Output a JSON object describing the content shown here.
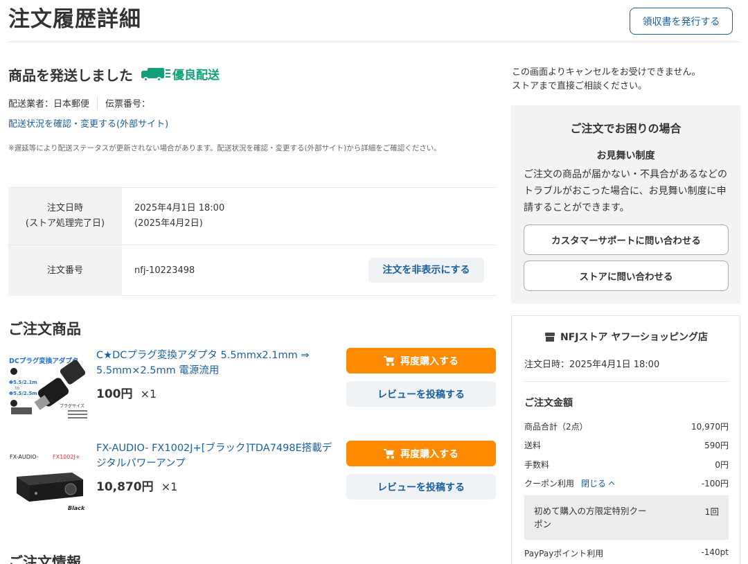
{
  "page": {
    "title": "注文履歴詳細",
    "receipt_button": "領収書を発行する"
  },
  "shipping": {
    "status": "商品を発送しました",
    "badge": "優良配送",
    "carrier_label": "配送業者：日本郵便",
    "tracking_label": "伝票番号：",
    "track_link": "配送状況を確認・変更する(外部サイト)",
    "note": "※遅延等により配送ステータスが更新されない場合があります。配送状況を確認・変更する(外部サイト)から詳細をご確認ください。"
  },
  "order_info": {
    "date_header_line1": "注文日時",
    "date_header_line2": "(ストア処理完了日)",
    "date_value": "2025年4月1日 18:00",
    "date_processed": "(2025年4月2日)",
    "number_header": "注文番号",
    "number_value": "nfj-10223498",
    "hide_button": "注文を非表示にする"
  },
  "items_section": {
    "title": "ご注文商品",
    "next_section_title": "ご注文情報",
    "items": [
      {
        "name": "C★DCプラグ変換アダプタ 5.5mmx2.1mm ⇒ 5.5mm×2.5mm 電源流用",
        "price": "100円",
        "qty": "×1",
        "rebuy_label": "再度購入する",
        "review_label": "レビューを投稿する",
        "thumb": {
          "title": "DCプラグ変換アダプタ",
          "spec1": "Φ5.5/2.1m",
          "spec_to": "to",
          "spec2": "Φ5.5/2.5m",
          "caption": "プラグサイズ"
        }
      },
      {
        "name": "FX-AUDIO- FX1002J+[ブラック]TDA7498E搭載デジタルパワーアンプ",
        "price": "10,870円",
        "qty": "×1",
        "rebuy_label": "再度購入する",
        "review_label": "レビューを投稿する",
        "thumb": {
          "brand": "FX-AUDIO-",
          "model": "FX1002J+",
          "color": "Black"
        }
      }
    ]
  },
  "sidebar": {
    "cancel_note_line1": "この画面よりキャンセルをお受けできません。",
    "cancel_note_line2": "ストアまで直接ご相談ください。",
    "help": {
      "title": "ご注文でお困りの場合",
      "subtitle": "お見舞い制度",
      "text": "ご注文の商品が届かない・不具合があるなどのトラブルがおこった場合に、お見舞い制度に申請することができます。",
      "support_button": "カスタマーサポートに問い合わせる",
      "store_button": "ストアに問い合わせる"
    },
    "store": {
      "name": "NFJストア ヤフーショッピング店",
      "order_date": "注文日時：2025年4月1日 18:00",
      "amount_title": "ご注文金額",
      "rows": [
        {
          "label": "商品合計（2点）",
          "value": "10,970円"
        },
        {
          "label": "送料",
          "value": "590円"
        },
        {
          "label": "手数料",
          "value": "0円"
        },
        {
          "label": "クーポン利用",
          "value": "-100円",
          "toggle": "閉じる"
        },
        {
          "label": "PayPayポイント利用",
          "value": "-140pt"
        }
      ],
      "coupon": {
        "name": "初めて購入の方限定特別クーポン",
        "count": "1回"
      }
    }
  },
  "colors": {
    "link": "#1a5f9e",
    "badge_green": "#12a07a",
    "rebuy_orange": "#ff8a00"
  }
}
